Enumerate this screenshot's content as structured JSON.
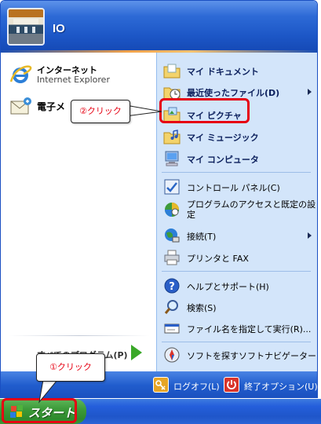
{
  "user": {
    "name": "IO"
  },
  "pinned": [
    {
      "title": "インターネット",
      "subtitle": "Internet Explorer",
      "icon": "internet-explorer-icon"
    },
    {
      "title": "電子メ",
      "subtitle": "",
      "icon": "email-icon"
    }
  ],
  "all_programs": {
    "label": "すべてのプログラム(P)"
  },
  "right_items": [
    {
      "label": "マイ ドキュメント",
      "icon": "my-documents-folder-icon",
      "bold": true
    },
    {
      "label": "最近使ったファイル(D)",
      "icon": "recent-documents-icon",
      "bold": true,
      "submenu": true
    },
    {
      "label": "マイ ピクチャ",
      "icon": "my-pictures-folder-icon",
      "bold": true
    },
    {
      "label": "マイ ミュージック",
      "icon": "my-music-folder-icon",
      "bold": true
    },
    {
      "label": "マイ コンピュータ",
      "icon": "my-computer-icon",
      "bold": true
    },
    {
      "label": "コントロール パネル(C)",
      "icon": "control-panel-icon",
      "bold": false
    },
    {
      "label": "プログラムのアクセスと既定の設",
      "label_line2": "定",
      "icon": "program-access-icon",
      "bold": false
    },
    {
      "label": "接続(T)",
      "icon": "connect-icon",
      "bold": false,
      "submenu": true
    },
    {
      "label": "プリンタと FAX",
      "icon": "printer-icon",
      "bold": false
    },
    {
      "label": "ヘルプとサポート(H)",
      "icon": "help-icon",
      "bold": false
    },
    {
      "label": "検索(S)",
      "icon": "search-icon",
      "bold": false
    },
    {
      "label": "ファイル名を指定して実行(R)...",
      "icon": "run-icon",
      "bold": false
    },
    {
      "label": "ソフトを探すソフトナビゲーター",
      "icon": "soft-navigator-icon",
      "bold": false
    }
  ],
  "footer": {
    "logoff": "ログオフ(L)",
    "shutdown": "終了オプション(U)"
  },
  "taskbar": {
    "start_label": "スタート"
  },
  "callouts": {
    "step1": "①クリック",
    "step2": "②クリック"
  },
  "colors": {
    "accent_red": "#e60012",
    "start_green": "#3d9b3a",
    "menu_blue": "#1c56c6"
  }
}
